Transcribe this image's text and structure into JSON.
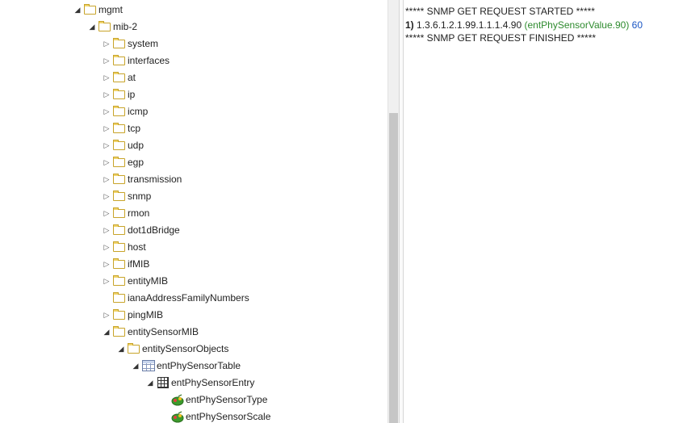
{
  "tree": {
    "nodes": [
      {
        "label": "mgmt",
        "icon": "folder",
        "state": "expanded"
      },
      {
        "label": "mib-2",
        "icon": "folder",
        "state": "expanded"
      },
      {
        "label": "system",
        "icon": "folder",
        "state": "collapsed"
      },
      {
        "label": "interfaces",
        "icon": "folder",
        "state": "collapsed"
      },
      {
        "label": "at",
        "icon": "folder",
        "state": "collapsed"
      },
      {
        "label": "ip",
        "icon": "folder",
        "state": "collapsed"
      },
      {
        "label": "icmp",
        "icon": "folder",
        "state": "collapsed"
      },
      {
        "label": "tcp",
        "icon": "folder",
        "state": "collapsed"
      },
      {
        "label": "udp",
        "icon": "folder",
        "state": "collapsed"
      },
      {
        "label": "egp",
        "icon": "folder",
        "state": "collapsed"
      },
      {
        "label": "transmission",
        "icon": "folder",
        "state": "collapsed"
      },
      {
        "label": "snmp",
        "icon": "folder",
        "state": "collapsed"
      },
      {
        "label": "rmon",
        "icon": "folder",
        "state": "collapsed"
      },
      {
        "label": "dot1dBridge",
        "icon": "folder",
        "state": "collapsed"
      },
      {
        "label": "host",
        "icon": "folder",
        "state": "collapsed"
      },
      {
        "label": "ifMIB",
        "icon": "folder",
        "state": "collapsed"
      },
      {
        "label": "entityMIB",
        "icon": "folder",
        "state": "collapsed"
      },
      {
        "label": "ianaAddressFamilyNumbers",
        "icon": "folder",
        "state": "leaf"
      },
      {
        "label": "pingMIB",
        "icon": "folder",
        "state": "collapsed"
      },
      {
        "label": "entitySensorMIB",
        "icon": "folder",
        "state": "expanded"
      },
      {
        "label": "entitySensorObjects",
        "icon": "folder",
        "state": "expanded"
      },
      {
        "label": "entPhySensorTable",
        "icon": "table",
        "state": "expanded"
      },
      {
        "label": "entPhySensorEntry",
        "icon": "grid",
        "state": "expanded"
      },
      {
        "label": "entPhySensorType",
        "icon": "leaf",
        "state": "leaf"
      },
      {
        "label": "entPhySensorScale",
        "icon": "leaf",
        "state": "leaf"
      }
    ]
  },
  "output": {
    "start_line": "***** SNMP GET REQUEST STARTED *****",
    "result": {
      "index": "1)",
      "oid": "1.3.6.1.2.1.99.1.1.1.4.90",
      "name": "(entPhySensorValue.90)",
      "value": "60"
    },
    "finish_line": "***** SNMP GET REQUEST FINISHED *****"
  },
  "colors": {
    "folder_border": "#c8a42a",
    "oid_name": "#2e8b2e",
    "oid_value": "#1a56c4"
  }
}
